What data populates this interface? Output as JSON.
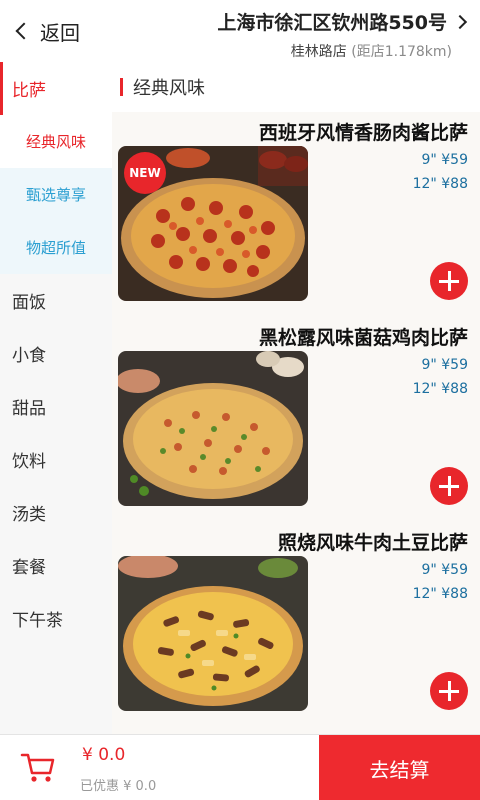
{
  "header": {
    "back_label": "返回",
    "store_address": "上海市徐汇区钦州路550号",
    "store_name": "桂林路店",
    "store_distance": "(距店1.178km)"
  },
  "sidebar": {
    "categories": [
      {
        "label": "比萨",
        "active": true
      },
      {
        "label": "面饭"
      },
      {
        "label": "小食"
      },
      {
        "label": "甜品"
      },
      {
        "label": "饮料"
      },
      {
        "label": "汤类"
      },
      {
        "label": "套餐"
      },
      {
        "label": "下午茶"
      }
    ],
    "subcategories": [
      {
        "label": "经典风味",
        "active": true
      },
      {
        "label": "甄选尊享"
      },
      {
        "label": "物超所值"
      }
    ]
  },
  "main": {
    "section_title": "经典风味",
    "products": [
      {
        "name": "西班牙风情香肠肉酱比萨",
        "price_9": "9\" ¥59",
        "price_12": "12\" ¥88",
        "badge": "NEW"
      },
      {
        "name": "黑松露风味菌菇鸡肉比萨",
        "price_9": "9\" ¥59",
        "price_12": "12\" ¥88"
      },
      {
        "name": "照烧风味牛肉土豆比萨",
        "price_9": "9\" ¥59",
        "price_12": "12\" ¥88"
      }
    ]
  },
  "bottom": {
    "total": "¥ 0.0",
    "discount": "已优惠 ¥ 0.0",
    "checkout_label": "去结算"
  },
  "colors": {
    "accent_red": "#e8262b",
    "price_blue": "#1c6f9f",
    "sub_blue": "#2b9fd1"
  },
  "icons": [
    "back-chevron-icon",
    "forward-chevron-icon",
    "plus-icon",
    "cart-icon"
  ]
}
